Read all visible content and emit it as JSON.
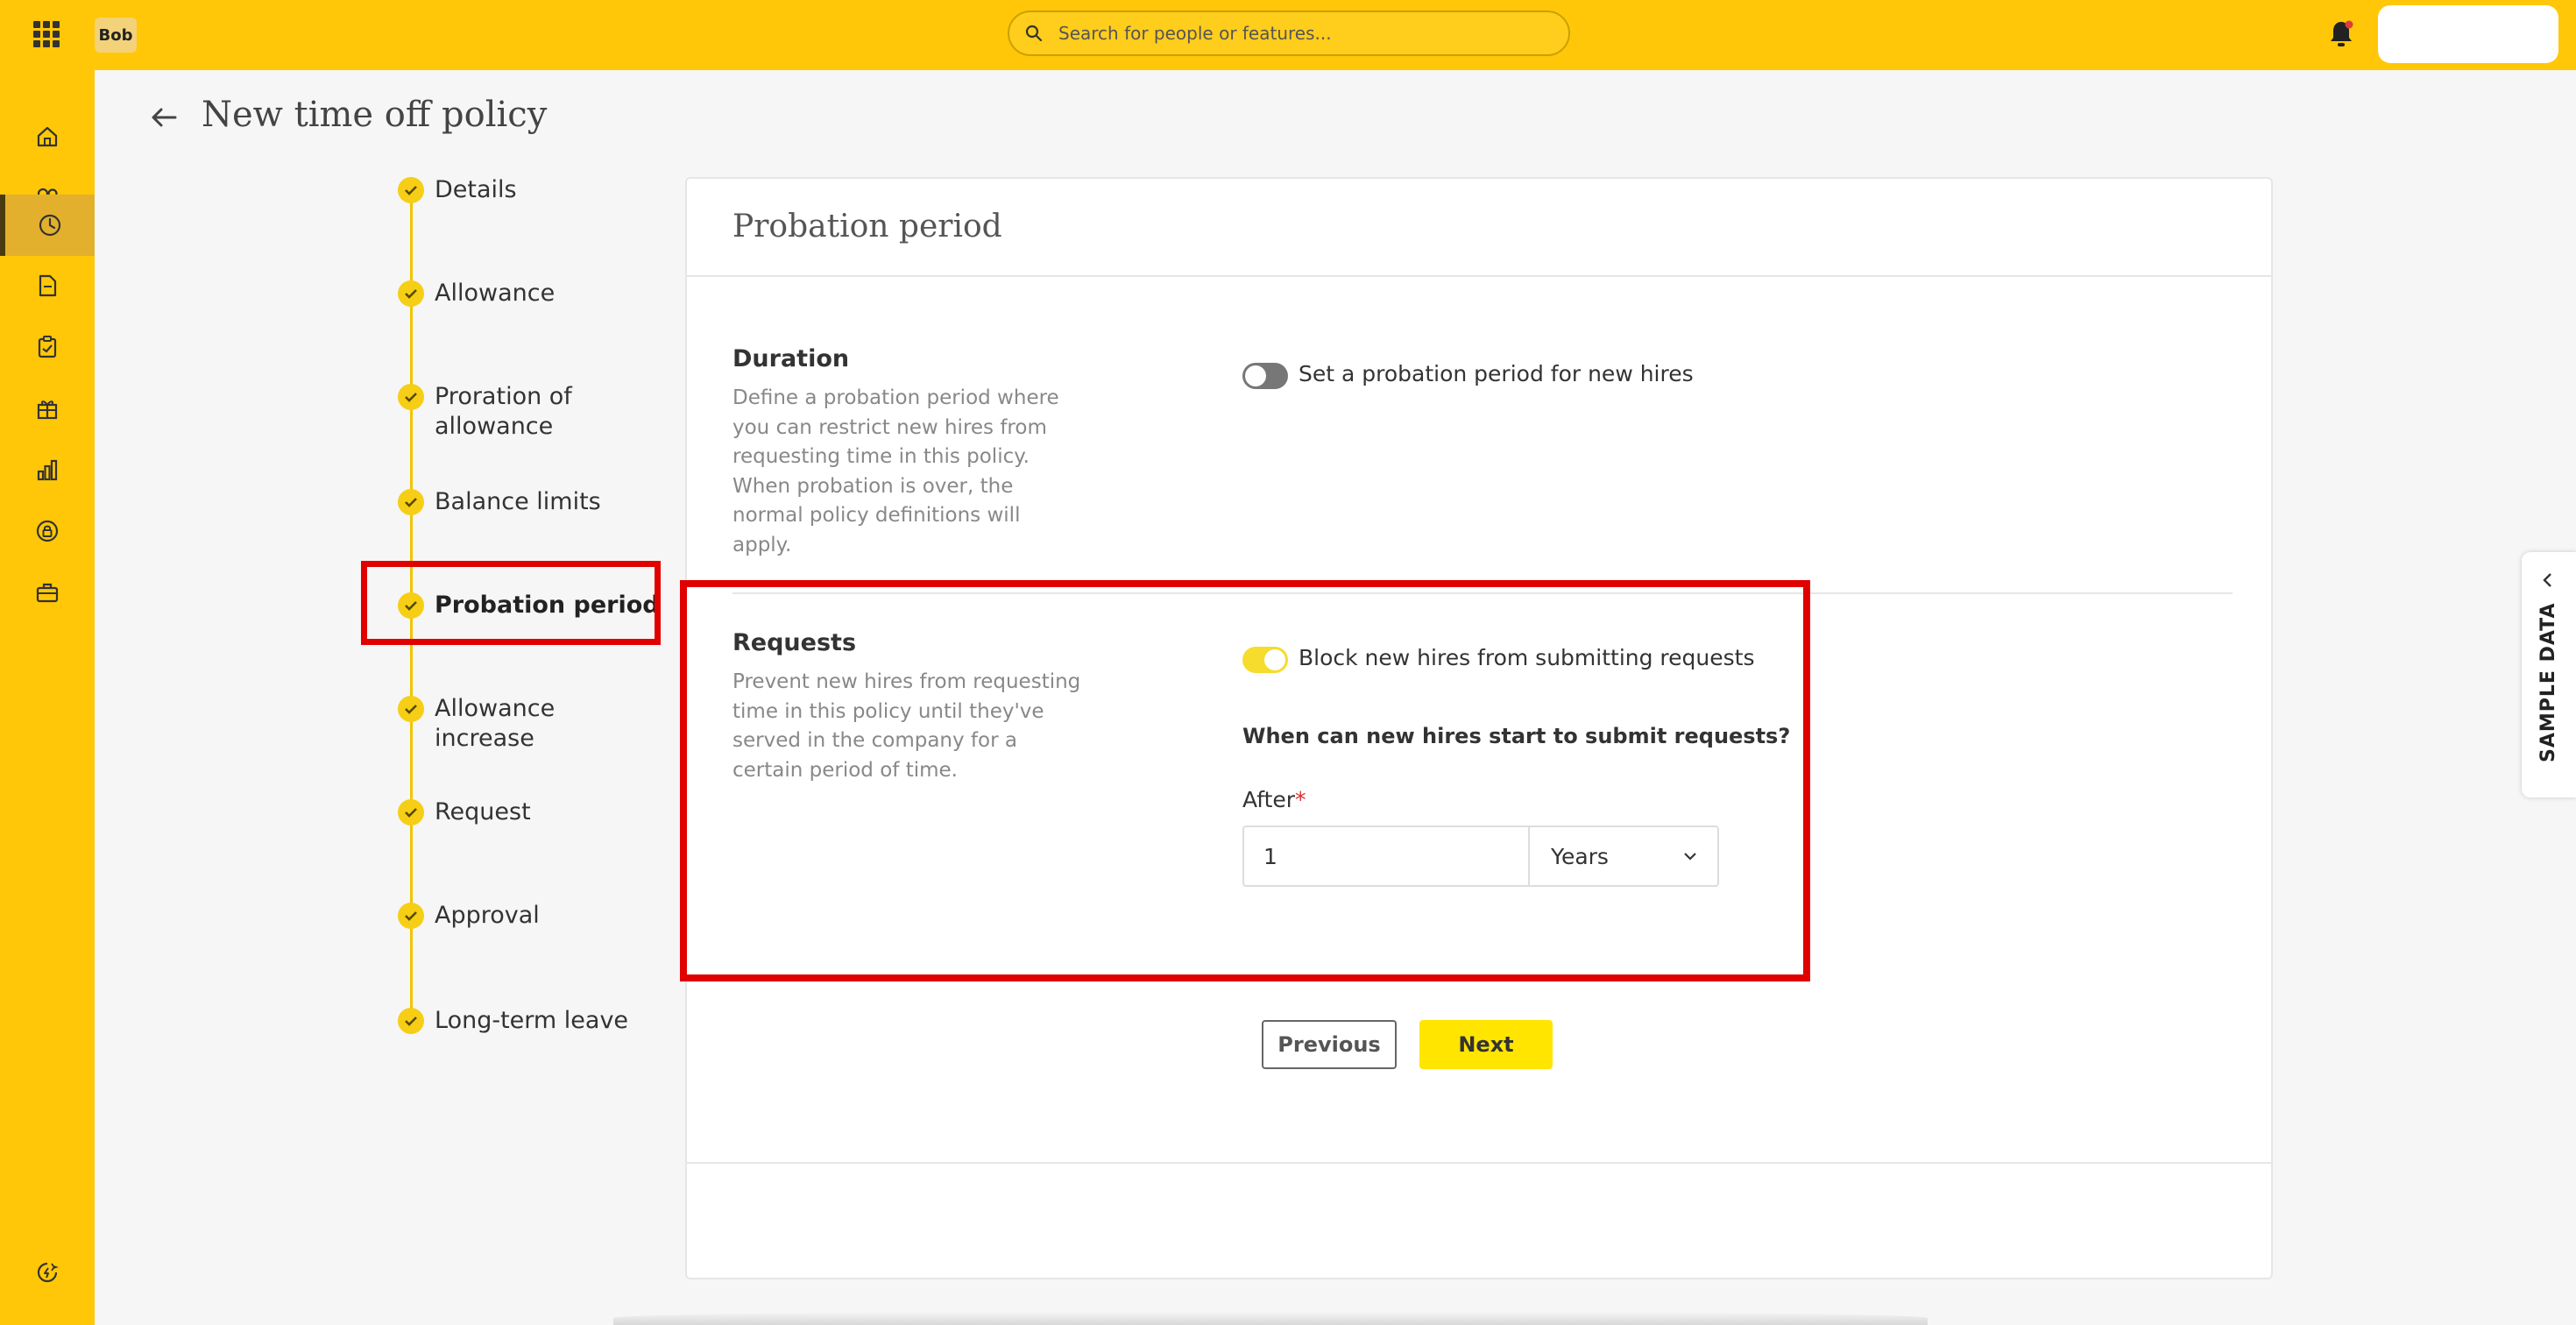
{
  "topbar": {
    "logo_text": "Bob",
    "search_placeholder": "Search for people or features...",
    "brand_color": "#ffc708"
  },
  "rail": {
    "items": [
      {
        "icon": "home-icon"
      },
      {
        "icon": "people-icon"
      },
      {
        "icon": "clock-icon",
        "active": true
      },
      {
        "icon": "document-icon"
      },
      {
        "icon": "clipboard-check-icon"
      },
      {
        "icon": "gift-icon"
      },
      {
        "icon": "analytics-icon"
      },
      {
        "icon": "lock-circle-icon"
      },
      {
        "icon": "briefcase-icon"
      }
    ],
    "bottom_icon": "whats-new-icon"
  },
  "page": {
    "title": "New time off policy"
  },
  "stepper": {
    "steps": [
      {
        "label": "Details"
      },
      {
        "label": "Allowance"
      },
      {
        "label": "Proration of allowance"
      },
      {
        "label": "Balance limits"
      },
      {
        "label": "Probation period",
        "current": true
      },
      {
        "label": "Allowance increase"
      },
      {
        "label": "Request"
      },
      {
        "label": "Approval"
      },
      {
        "label": "Long-term leave"
      }
    ]
  },
  "card": {
    "title": "Probation period",
    "duration": {
      "title": "Duration",
      "description": "Define a probation period where you can restrict new hires from requesting time in this policy. When probation is over, the normal policy definitions will apply.",
      "toggle_label": "Set a probation period for new hires",
      "toggle_on": false
    },
    "requests": {
      "title": "Requests",
      "description": "Prevent new hires from requesting time in this policy until they've served in the company for a certain period of time.",
      "toggle_label": "Block new hires from submitting requests",
      "toggle_on": true,
      "question": "When can new hires start to submit requests?",
      "after_label": "After",
      "required_mark": "*",
      "after_value": "1",
      "unit_value": "Years"
    },
    "buttons": {
      "previous": "Previous",
      "next": "Next"
    }
  },
  "side_tab": {
    "label": "SAMPLE DATA"
  },
  "annotation_color": "#e00000"
}
